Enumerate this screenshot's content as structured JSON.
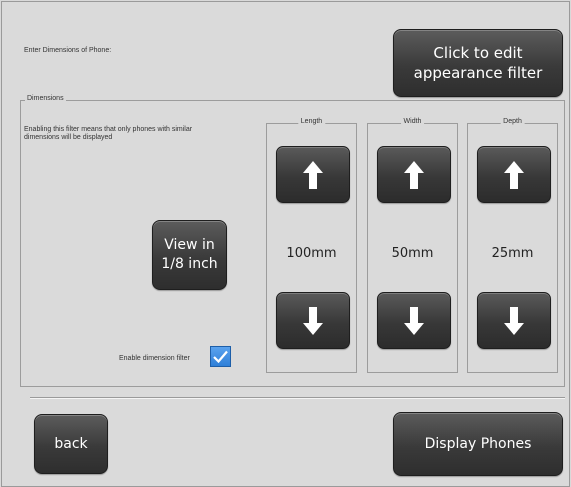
{
  "header": {
    "title_label": "Enter Dimensions of Phone:",
    "edit_appearance_button": "Click to edit\nappearance filter"
  },
  "dimensions": {
    "legend": "Dimensions",
    "description": "Enabling this filter means that only phones with similar dimensions will be displayed",
    "view_units_button": "View in\n1/8 inch",
    "enable_filter_label": "Enable dimension filter",
    "enable_filter_checked": true,
    "length": {
      "legend": "Length",
      "value": "100mm"
    },
    "width": {
      "legend": "Width",
      "value": "50mm"
    },
    "depth": {
      "legend": "Depth",
      "value": "25mm"
    }
  },
  "footer": {
    "back_button": "back",
    "display_phones_button": "Display Phones"
  },
  "icons": {
    "up": "arrow-up-icon",
    "down": "arrow-down-icon",
    "check": "checkmark-icon"
  },
  "colors": {
    "button_dark": "#3a3a3a",
    "checkbox_blue": "#3a8ae0",
    "background": "#dadada"
  }
}
